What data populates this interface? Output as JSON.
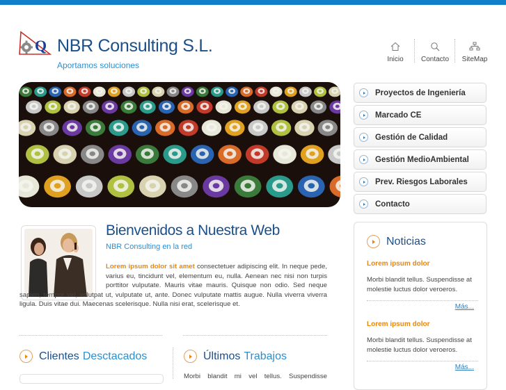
{
  "header": {
    "title": "NBR Consulting S.L.",
    "tagline": "Aportamos soluciones"
  },
  "topnav": [
    {
      "label": "Inicio",
      "icon": "home-icon"
    },
    {
      "label": "Contacto",
      "icon": "search-icon"
    },
    {
      "label": "SiteMap",
      "icon": "sitemap-icon"
    }
  ],
  "sidemenu": [
    "Proyectos de Ingeniería",
    "Marcado CE",
    "Gestión de Calidad",
    "Gestión MedioAmbiental",
    "Prev. Riesgos Laborales",
    "Contacto"
  ],
  "welcome": {
    "title": "Bienvenidos a Nuestra Web",
    "subtitle": "NBR Consulting en la red",
    "lead": "Lorem ipsum dolor sit amet",
    "body": " consectetuer adipiscing elit. In neque pede, varius eu, tincidunt vel, elementum eu, nulla. Aenean nec nisi non turpis porttitor vulputate. Mauris vitae mauris. Quisque non odio. Sed neque sapien, tempor vel, volutpat ut, vulputate ut, ante. Donec vulputate mattis augue. Nulla viverra viverra ligula. Duis vitae dui. Maecenas scelerisque. Nulla nisi erat, scelerisque et."
  },
  "clientes": {
    "title_a": "Clientes",
    "title_b": "Desctacados"
  },
  "trabajos": {
    "title_a": "Últimos",
    "title_b": "Trabajos",
    "text": "Morbi blandit mi vel tellus. Suspendisse"
  },
  "news": {
    "title": "Noticias",
    "items": [
      {
        "heading": "Lorem ipsum dolor",
        "text": "Morbi blandit tellus. Suspendisse at molestie luctus dolor veroeros.",
        "more": "Más..."
      },
      {
        "heading": "Lorem ipsum dolor",
        "text": "Morbi blandit tellus. Suspendisse at molestie luctus dolor veroeros.",
        "more": "Más..."
      }
    ]
  },
  "colors": {
    "accent": "#0e7fc8",
    "title": "#1b4f8a",
    "link": "#2a8fd0",
    "highlight": "#e8870e"
  }
}
